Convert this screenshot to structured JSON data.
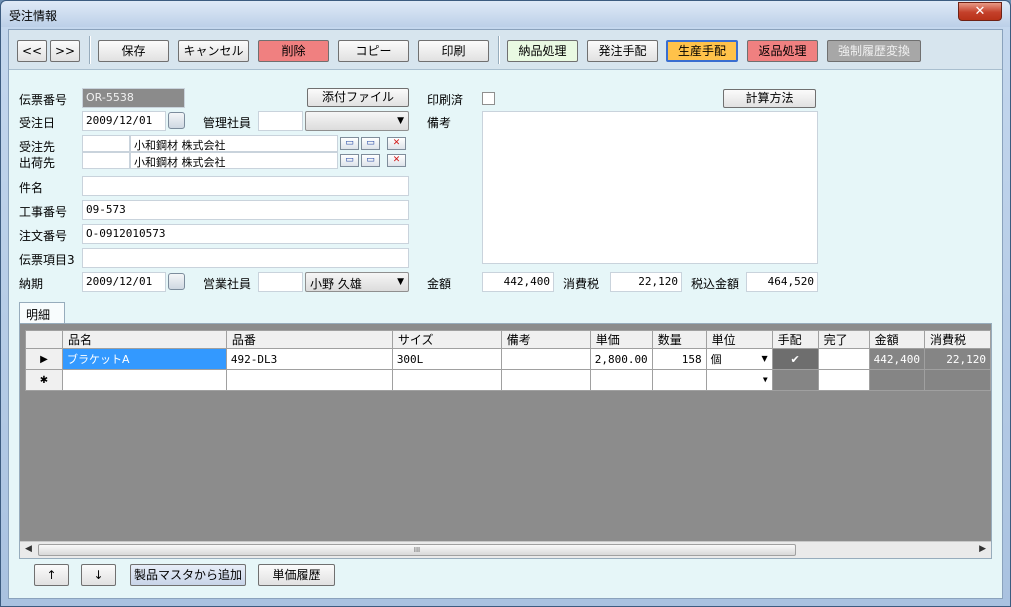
{
  "window": {
    "title": "受注情報",
    "close_glyph": "✕"
  },
  "toolbar": {
    "prev_label": "<<",
    "next_label": ">>",
    "save_label": "保存",
    "cancel_label": "キャンセル",
    "delete_label": "削除",
    "copy_label": "コピー",
    "print_label": "印刷",
    "delivery_label": "納品処理",
    "order_arrange_label": "発注手配",
    "production_label": "生産手配",
    "return_label": "返品処理",
    "force_history_label": "強制履歴変換"
  },
  "form": {
    "slip_no_label": "伝票番号",
    "slip_no_value": "OR-5538",
    "attach_label": "添付ファイル",
    "printed_label": "印刷済",
    "calc_method_label": "計算方法",
    "order_date_label": "受注日",
    "order_date_value": "2009/12/01",
    "manager_label": "管理社員",
    "manager_value": "",
    "remarks_label": "備考",
    "customer_label": "受注先",
    "customer_code": "",
    "customer_name": "小和鋼材 株式会社",
    "shipto_label": "出荷先",
    "shipto_code": "",
    "shipto_name": "小和鋼材 株式会社",
    "subject_label": "件名",
    "subject_value": "",
    "construction_label": "工事番号",
    "construction_value": "09-573",
    "po_label": "注文番号",
    "po_value": "O-0912010573",
    "slip_item3_label": "伝票項目3",
    "slip_item3_value": "",
    "due_label": "納期",
    "due_value": "2009/12/01",
    "sales_staff_label": "営業社員",
    "sales_staff_code": "",
    "sales_staff_name": "小野 久雄",
    "amount_label": "金額",
    "amount_value": "442,400",
    "tax_label": "消費税",
    "tax_value": "22,120",
    "total_label": "税込金額",
    "total_value": "464,520"
  },
  "detail": {
    "tab_label": "明細",
    "columns": [
      "品名",
      "品番",
      "サイズ",
      "備考",
      "単価",
      "数量",
      "単位",
      "手配",
      "完了",
      "金額",
      "消費税"
    ],
    "rows": [
      {
        "marker": "▶",
        "name": "ブラケットA",
        "part_no": "492-DL3",
        "size": "300L",
        "note": "",
        "unit_price": "2,800.00",
        "qty": "158",
        "unit": "個",
        "arranged": "✔",
        "done": "",
        "amount": "442,400",
        "tax": "22,120"
      }
    ],
    "new_row_marker": "✱",
    "scroll_thumb_text": "III"
  },
  "bottom": {
    "up_label": "↑",
    "down_label": "↓",
    "add_from_master_label": "製品マスタから追加",
    "price_history_label": "単価履歴"
  },
  "colors": {
    "delete_button": "#f08080",
    "production_button": "#ffc24a",
    "selected_cell": "#3399ff"
  }
}
